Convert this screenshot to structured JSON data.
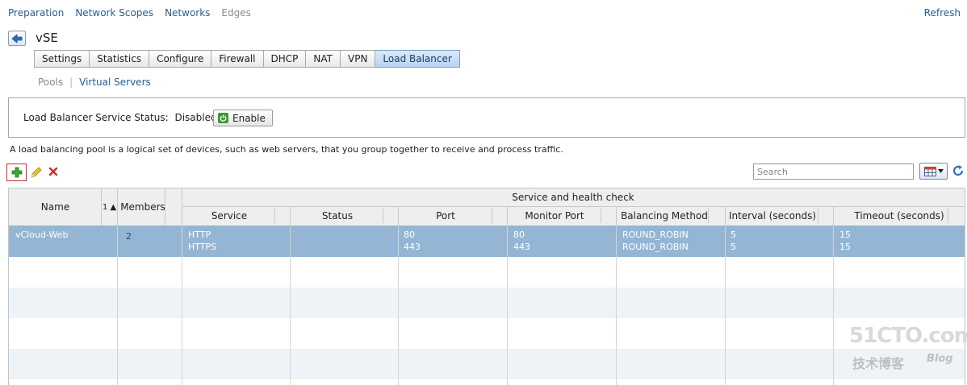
{
  "nav": {
    "items": [
      "Preparation",
      "Network Scopes",
      "Networks",
      "Edges"
    ],
    "refresh": "Refresh"
  },
  "edge": {
    "title": "vSE"
  },
  "tabs": [
    "Settings",
    "Statistics",
    "Configure",
    "Firewall",
    "DHCP",
    "NAT",
    "VPN",
    "Load Balancer"
  ],
  "active_tab": "Load Balancer",
  "subtabs": {
    "pools": "Pools",
    "separator": "|",
    "virtual_servers": "Virtual Servers"
  },
  "service_status": {
    "label": "Load Balancer Service Status:",
    "value": "Disabled",
    "enable_button": "Enable"
  },
  "description": "A load balancing pool is a logical set of devices, such as web servers, that you group together to receive and process traffic.",
  "toolbar": {
    "add_icon": "add-icon",
    "edit_icon": "pencil-icon",
    "delete_icon": "delete-icon",
    "search_placeholder": "Search",
    "column_picker_icon": "table-columns-icon",
    "refresh_icon": "refresh-icon"
  },
  "table": {
    "headers": {
      "name": "Name",
      "sort_indicator": "1 ▲",
      "members": "Members",
      "group": "Service and health check",
      "service": "Service",
      "status": "Status",
      "port": "Port",
      "monitor_port": "Monitor Port",
      "balancing_method": "Balancing Method",
      "interval": "Interval (seconds)",
      "timeout": "Timeout (seconds)"
    },
    "rows": [
      {
        "name": "vCloud-Web",
        "members": "2",
        "service": [
          "HTTP",
          "HTTPS"
        ],
        "status": [
          "",
          ""
        ],
        "port": [
          "80",
          "443"
        ],
        "monitor_port": [
          "80",
          "443"
        ],
        "balancing_method": [
          "ROUND_ROBIN",
          "ROUND_ROBIN"
        ],
        "interval": [
          "5",
          "5"
        ],
        "timeout": [
          "15",
          "15"
        ]
      }
    ]
  },
  "watermark": {
    "main": "51CTO.com",
    "sub": "技术博客",
    "blog": "Blog"
  },
  "colors": {
    "link": "#2a5c8f",
    "selected_row": "#94b6d4",
    "active_tab": "#b9d2f2"
  }
}
